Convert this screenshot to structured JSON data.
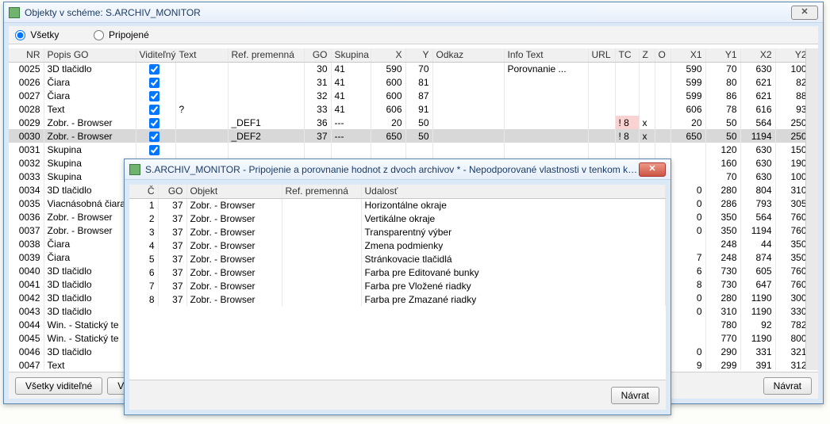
{
  "main": {
    "title": "Objekty v schéme: S.ARCHIV_MONITOR",
    "radios": {
      "all": "Všetky",
      "connected": "Pripojené"
    },
    "cols": [
      "NR",
      "Popis GO",
      "Viditeľný",
      "Text",
      "Ref. premenná",
      "GO",
      "Skupina",
      "X",
      "Y",
      "Odkaz",
      "Info Text",
      "URL",
      "TC",
      "Z",
      "O",
      "X1",
      "Y1",
      "X2",
      "Y2"
    ],
    "rows": [
      {
        "nr": "0025",
        "popis": "3D tlačidlo",
        "vid": true,
        "text": "",
        "ref": "",
        "go": "30",
        "sk": "41",
        "x": "590",
        "y": "70",
        "odk": "",
        "info": "Porovnanie ...",
        "url": "",
        "tc": "",
        "z": "",
        "o": "",
        "x1": "590",
        "y1": "70",
        "x2": "630",
        "y2": "100"
      },
      {
        "nr": "0026",
        "popis": "Čiara",
        "vid": true,
        "text": "",
        "ref": "",
        "go": "31",
        "sk": "41",
        "x": "600",
        "y": "81",
        "odk": "",
        "info": "",
        "url": "",
        "tc": "",
        "z": "",
        "o": "",
        "x1": "599",
        "y1": "80",
        "x2": "621",
        "y2": "82"
      },
      {
        "nr": "0027",
        "popis": "Čiara",
        "vid": true,
        "text": "",
        "ref": "",
        "go": "32",
        "sk": "41",
        "x": "600",
        "y": "87",
        "odk": "",
        "info": "",
        "url": "",
        "tc": "",
        "z": "",
        "o": "",
        "x1": "599",
        "y1": "86",
        "x2": "621",
        "y2": "88"
      },
      {
        "nr": "0028",
        "popis": "Text",
        "vid": true,
        "text": "?",
        "ref": "",
        "go": "33",
        "sk": "41",
        "x": "606",
        "y": "91",
        "odk": "",
        "info": "",
        "url": "",
        "tc": "",
        "z": "",
        "o": "",
        "x1": "606",
        "y1": "78",
        "x2": "616",
        "y2": "93"
      },
      {
        "nr": "0029",
        "popis": "Zobr. - Browser",
        "vid": true,
        "text": "",
        "ref": "_DEF1",
        "go": "36",
        "sk": "---",
        "x": "20",
        "y": "50",
        "odk": "",
        "info": "",
        "url": "",
        "tc": "! 8",
        "z": "x",
        "o": "",
        "x1": "20",
        "y1": "50",
        "x2": "564",
        "y2": "250"
      },
      {
        "nr": "0030",
        "popis": "Zobr. - Browser",
        "vid": true,
        "text": "",
        "ref": "_DEF2",
        "go": "37",
        "sk": "---",
        "x": "650",
        "y": "50",
        "odk": "",
        "info": "",
        "url": "",
        "tc": "! 8",
        "z": "x",
        "o": "",
        "x1": "650",
        "y1": "50",
        "x2": "1194",
        "y2": "250",
        "sel": true
      },
      {
        "nr": "0031",
        "popis": "Skupina",
        "vid": true,
        "text": "",
        "ref": "",
        "go": "",
        "sk": "",
        "x": "",
        "y": "",
        "odk": "",
        "info": "",
        "url": "",
        "tc": "",
        "z": "",
        "o": "",
        "x1": "",
        "y1": "120",
        "x2": "630",
        "y2": "150"
      },
      {
        "nr": "0032",
        "popis": "Skupina",
        "vid": "",
        "text": "",
        "ref": "",
        "go": "",
        "sk": "",
        "x": "",
        "y": "",
        "odk": "",
        "info": "",
        "url": "",
        "tc": "",
        "z": "",
        "o": "",
        "x1": "",
        "y1": "160",
        "x2": "630",
        "y2": "190"
      },
      {
        "nr": "0033",
        "popis": "Skupina",
        "vid": "",
        "text": "",
        "ref": "",
        "go": "",
        "sk": "",
        "x": "",
        "y": "",
        "odk": "",
        "info": "",
        "url": "",
        "tc": "",
        "z": "",
        "o": "",
        "x1": "",
        "y1": "70",
        "x2": "630",
        "y2": "100"
      },
      {
        "nr": "0034",
        "popis": "3D tlačidlo",
        "vid": "",
        "text": "",
        "ref": "",
        "go": "",
        "sk": "",
        "x": "",
        "y": "",
        "odk": "",
        "info": "",
        "url": "",
        "tc": "",
        "z": "",
        "o": "",
        "x1": "0",
        "y1": "280",
        "x2": "804",
        "y2": "310"
      },
      {
        "nr": "0035",
        "popis": "Viacnásobná čiara",
        "vid": "",
        "text": "",
        "ref": "",
        "go": "",
        "sk": "",
        "x": "",
        "y": "",
        "odk": "",
        "info": "",
        "url": "",
        "tc": "",
        "z": "",
        "o": "",
        "x1": "0",
        "y1": "286",
        "x2": "793",
        "y2": "305"
      },
      {
        "nr": "0036",
        "popis": "Zobr. - Browser",
        "vid": "",
        "text": "",
        "ref": "",
        "go": "",
        "sk": "",
        "x": "",
        "y": "",
        "odk": "",
        "info": "",
        "url": "",
        "tc": "",
        "z": "",
        "o": "",
        "x1": "0",
        "y1": "350",
        "x2": "564",
        "y2": "760"
      },
      {
        "nr": "0037",
        "popis": "Zobr. - Browser",
        "vid": "",
        "text": "",
        "ref": "",
        "go": "",
        "sk": "",
        "x": "",
        "y": "",
        "odk": "",
        "info": "",
        "url": "",
        "tc": "",
        "z": "",
        "o": "",
        "x1": "0",
        "y1": "350",
        "x2": "1194",
        "y2": "760"
      },
      {
        "nr": "0038",
        "popis": "Čiara",
        "vid": "",
        "text": "",
        "ref": "",
        "go": "",
        "sk": "",
        "x": "",
        "y": "",
        "odk": "",
        "info": "",
        "url": "",
        "tc": "",
        "z": "",
        "o": "",
        "x1": "",
        "y1": "248",
        "x2": "44",
        "y2": "350"
      },
      {
        "nr": "0039",
        "popis": "Čiara",
        "vid": "",
        "text": "",
        "ref": "",
        "go": "",
        "sk": "",
        "x": "",
        "y": "",
        "odk": "",
        "info": "",
        "url": "",
        "tc": "",
        "z": "",
        "o": "",
        "x1": "7",
        "y1": "248",
        "x2": "874",
        "y2": "350"
      },
      {
        "nr": "0040",
        "popis": "3D tlačidlo",
        "vid": "",
        "text": "",
        "ref": "",
        "go": "",
        "sk": "",
        "x": "",
        "y": "",
        "odk": "",
        "info": "",
        "url": "",
        "tc": "",
        "z": "",
        "o": "",
        "x1": "6",
        "y1": "730",
        "x2": "605",
        "y2": "760"
      },
      {
        "nr": "0041",
        "popis": "3D tlačidlo",
        "vid": "",
        "text": "",
        "ref": "",
        "go": "",
        "sk": "",
        "x": "",
        "y": "",
        "odk": "",
        "info": "",
        "url": "",
        "tc": "",
        "z": "",
        "o": "",
        "x1": "8",
        "y1": "730",
        "x2": "647",
        "y2": "760"
      },
      {
        "nr": "0042",
        "popis": "3D tlačidlo",
        "vid": "",
        "text": "",
        "ref": "",
        "go": "",
        "sk": "",
        "x": "",
        "y": "",
        "odk": "",
        "info": "",
        "url": "",
        "tc": "",
        "z": "",
        "o": "",
        "x1": "0",
        "y1": "280",
        "x2": "1190",
        "y2": "300"
      },
      {
        "nr": "0043",
        "popis": "3D tlačidlo",
        "vid": "",
        "text": "",
        "ref": "",
        "go": "",
        "sk": "",
        "x": "",
        "y": "",
        "odk": "",
        "info": "",
        "url": "",
        "tc": "",
        "z": "",
        "o": "",
        "x1": "0",
        "y1": "310",
        "x2": "1190",
        "y2": "330"
      },
      {
        "nr": "0044",
        "popis": "Win. - Statický te",
        "vid": "",
        "text": "",
        "ref": "",
        "go": "",
        "sk": "",
        "x": "",
        "y": "",
        "odk": "",
        "info": "",
        "url": "",
        "tc": "",
        "z": "",
        "o": "",
        "x1": "",
        "y1": "780",
        "x2": "92",
        "y2": "782"
      },
      {
        "nr": "0045",
        "popis": "Win. - Statický te",
        "vid": "",
        "text": "",
        "ref": "",
        "go": "",
        "sk": "",
        "x": "",
        "y": "",
        "odk": "",
        "info": "",
        "url": "",
        "tc": "",
        "z": "",
        "o": "",
        "x1": "",
        "y1": "770",
        "x2": "1190",
        "y2": "800"
      },
      {
        "nr": "0046",
        "popis": "3D tlačidlo",
        "vid": "",
        "text": "",
        "ref": "",
        "go": "",
        "sk": "",
        "x": "",
        "y": "",
        "odk": "",
        "info": "",
        "url": "",
        "tc": "",
        "z": "",
        "o": "",
        "x1": "0",
        "y1": "290",
        "x2": "331",
        "y2": "321"
      },
      {
        "nr": "0047",
        "popis": "Text",
        "vid": "",
        "text": "",
        "ref": "",
        "go": "",
        "sk": "",
        "x": "",
        "y": "",
        "odk": "",
        "info": "",
        "url": "",
        "tc": "",
        "z": "",
        "o": "",
        "x1": "9",
        "y1": "299",
        "x2": "391",
        "y2": "312"
      }
    ],
    "buttons": {
      "all_visible": "Všetky viditeľné",
      "vs": "Vš",
      "back": "Návrat"
    }
  },
  "modal": {
    "title": "S.ARCHIV_MONITOR - Pripojenie a porovnanie hodnot z dvoch archivov * - Nepodporované vlastnosti v tenkom klien...",
    "cols": [
      "Č",
      "GO",
      "Objekt",
      "Ref. premenná",
      "Udalosť"
    ],
    "rows": [
      {
        "c": "1",
        "go": "37",
        "obj": "Zobr. - Browser",
        "ref": "",
        "ud": "Horizontálne okraje"
      },
      {
        "c": "2",
        "go": "37",
        "obj": "Zobr. - Browser",
        "ref": "",
        "ud": "Vertikálne okraje"
      },
      {
        "c": "3",
        "go": "37",
        "obj": "Zobr. - Browser",
        "ref": "",
        "ud": "Transparentný výber"
      },
      {
        "c": "4",
        "go": "37",
        "obj": "Zobr. - Browser",
        "ref": "",
        "ud": "Zmena podmienky"
      },
      {
        "c": "5",
        "go": "37",
        "obj": "Zobr. - Browser",
        "ref": "",
        "ud": "Stránkovacie tlačidlá"
      },
      {
        "c": "6",
        "go": "37",
        "obj": "Zobr. - Browser",
        "ref": "",
        "ud": "Farba pre Editované bunky"
      },
      {
        "c": "7",
        "go": "37",
        "obj": "Zobr. - Browser",
        "ref": "",
        "ud": "Farba pre Vložené riadky"
      },
      {
        "c": "8",
        "go": "37",
        "obj": "Zobr. - Browser",
        "ref": "",
        "ud": "Farba pre Zmazané riadky"
      }
    ],
    "back": "Návrat"
  }
}
